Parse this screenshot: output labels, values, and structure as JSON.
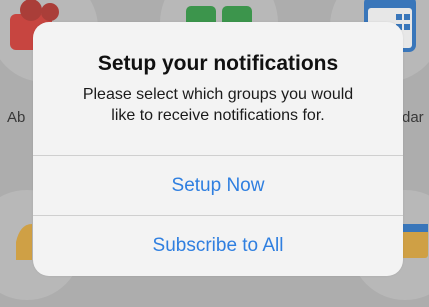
{
  "background": {
    "labels": {
      "left_fragment": "Ab",
      "right_fragment": "dar"
    },
    "icons": {
      "top_left": "contact-profile-icon",
      "top_center": "grid-icon",
      "top_right": "calendar-icon",
      "bottom_left": "bell-icon",
      "bottom_right": "news-icon"
    },
    "colors": {
      "red_icon": "#d83a34",
      "green_icon": "#2f9b43",
      "blue_icon": "#2b76c8",
      "yellow_icon": "#e2a93a"
    }
  },
  "alert": {
    "title": "Setup your notifications",
    "message_line1": "Please select which groups you would",
    "message_line2": "like to receive notifications for.",
    "buttons": {
      "setup_now": "Setup Now",
      "subscribe_all": "Subscribe to All"
    },
    "accent_color": "#2f7fe0"
  }
}
